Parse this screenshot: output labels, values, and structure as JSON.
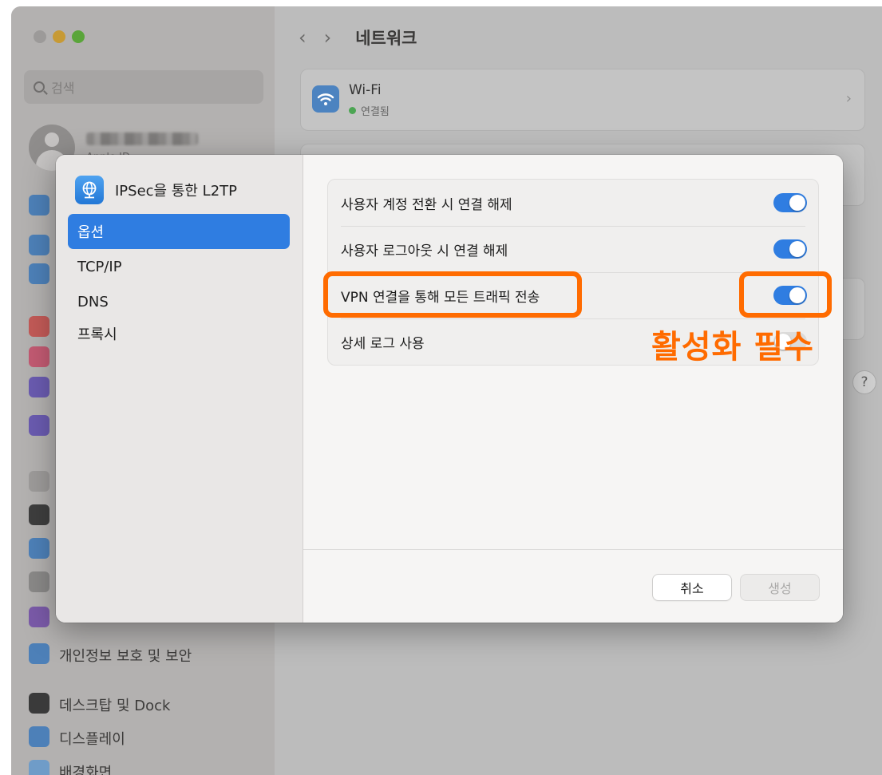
{
  "background": {
    "search_placeholder": "검색",
    "apple_id_label": "Apple ID",
    "nav_title": "네트워크",
    "sidebar_bottom_items": [
      {
        "label": "개인정보 보호 및 보안",
        "icon": "hand-icon"
      },
      {
        "label": "데스크탑 및 Dock",
        "icon": "dock-icon"
      },
      {
        "label": "디스플레이",
        "icon": "sun-icon"
      },
      {
        "label": "배경화면",
        "icon": "wallpaper-icon"
      }
    ],
    "wifi": {
      "name": "Wi-Fi",
      "status": "연결됨"
    },
    "help_label": "?"
  },
  "modal": {
    "title": "IPSec을 통한 L2TP",
    "side_items": [
      {
        "label": "옵션",
        "selected": true
      },
      {
        "label": "TCP/IP",
        "selected": false
      },
      {
        "label": "DNS",
        "selected": false
      },
      {
        "label": "프록시",
        "selected": false
      }
    ],
    "options": [
      {
        "label": "사용자 계정 전환 시 연결 해제",
        "enabled": true
      },
      {
        "label": "사용자 로그아웃 시 연결 해제",
        "enabled": true
      },
      {
        "label": "VPN 연결을 통해 모든 트래픽 전송",
        "enabled": true
      },
      {
        "label": "상세 로그 사용",
        "enabled": false
      }
    ],
    "cancel_label": "취소",
    "create_label": "생성"
  },
  "annotation": {
    "text": "활성화 필수",
    "color": "#ff6b00"
  },
  "colors": {
    "accent": "#2f7de1",
    "annotation": "#ff6b00"
  }
}
